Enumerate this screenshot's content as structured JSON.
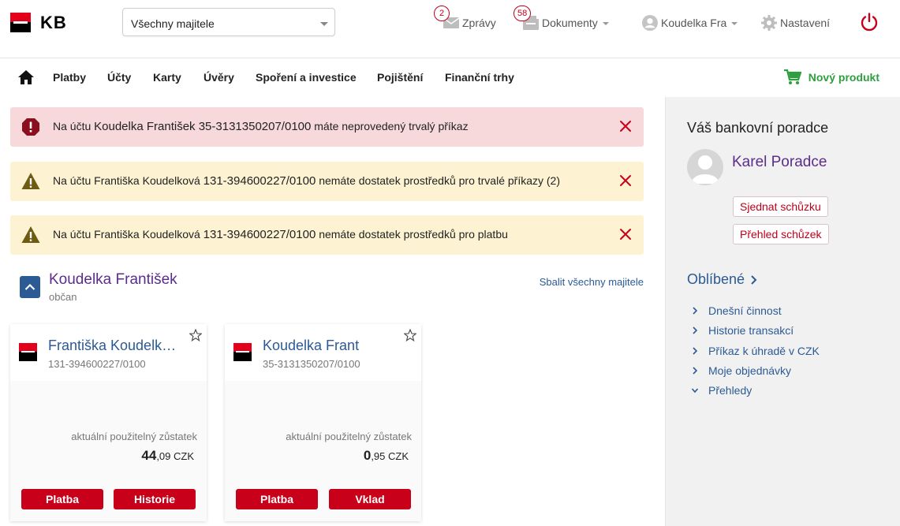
{
  "header": {
    "logo_text": "KB",
    "owner_select": {
      "value": "Všechny majitele"
    },
    "messages": {
      "label": "Zprávy",
      "count": "2"
    },
    "documents": {
      "label": "Dokumenty",
      "count": "58"
    },
    "user": {
      "label": "Koudelka Fra"
    },
    "settings": {
      "label": "Nastavení"
    }
  },
  "nav": {
    "items": [
      "Platby",
      "Účty",
      "Karty",
      "Úvěry",
      "Spoření a investice",
      "Pojištění",
      "Finanční trhy"
    ],
    "new_product": "Nový produkt"
  },
  "alerts": [
    {
      "type": "error",
      "prefix": "Na účtu",
      "account": "Koudelka František 35-3131350207/0100",
      "suffix": "máte neprovedený trvalý příkaz"
    },
    {
      "type": "warning",
      "prefix": "Na účtu Františka Koudelková",
      "account": "131-394600227/0100",
      "suffix": "nemáte dostatek prostředků pro trvalé příkazy (2)"
    },
    {
      "type": "warning",
      "prefix": "Na účtu Františka Koudelková",
      "account": "131-394600227/0100",
      "suffix": "nemáte dostatek prostředků pro platbu"
    }
  ],
  "owner": {
    "name": "Koudelka František",
    "type": "občan",
    "collapse_all": "Sbalit všechny majitele"
  },
  "accounts": [
    {
      "title": "Františka Koudelková",
      "number": "131-394600227/0100",
      "balance_label": "aktuální použitelný zůstatek",
      "balance_int": "44",
      "balance_dec": ",09 CZK",
      "buttons": [
        "Platba",
        "Historie"
      ]
    },
    {
      "title": "Koudelka Frant",
      "number": "35-3131350207/0100",
      "balance_label": "aktuální použitelný zůstatek",
      "balance_int": "0",
      "balance_dec": ",95 CZK",
      "buttons": [
        "Platba",
        "Vklad"
      ]
    }
  ],
  "adviser": {
    "heading": "Váš bankovní poradce",
    "name": "Karel Poradce",
    "buttons": [
      "Sjednat schůzku",
      "Přehled schůzek"
    ]
  },
  "favorites": {
    "heading": "Oblíbené",
    "items": [
      "Dnešní činnost",
      "Historie transakcí",
      "Příkaz k úhradě v CZK",
      "Moje objednávky",
      "Přehledy"
    ]
  },
  "colors": {
    "brand_red": "#c8001a",
    "link_blue": "#2b5a95",
    "purple": "#5c2d8c",
    "success_green": "#2e9e3e",
    "error_bg": "#f7d9dc",
    "warning_bg": "#fdf3d2"
  }
}
